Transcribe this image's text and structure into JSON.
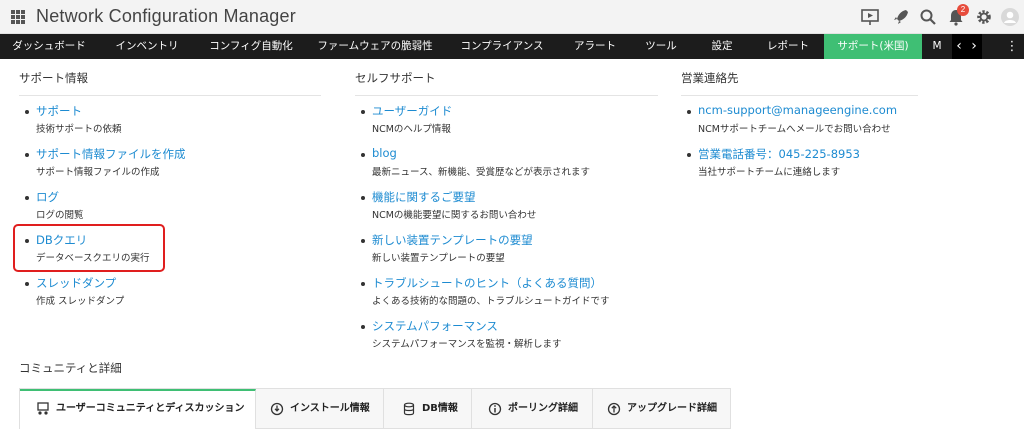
{
  "header": {
    "app_title": "Network Configuration Manager",
    "notification_count": "2",
    "icons": [
      "apps-grid-icon",
      "presentation-icon",
      "rocket-icon",
      "search-icon",
      "bell-icon",
      "gear-icon",
      "user-avatar-icon"
    ]
  },
  "nav": {
    "items": [
      "ダッシュボード",
      "インベントリ",
      "コンフィグ自動化",
      "ファームウェアの脆弱性",
      "コンプライアンス",
      "アラート",
      "ツール",
      "設定",
      "レポート",
      "サポート(米国)",
      "M"
    ],
    "active_color": "#3fbf74"
  },
  "support": {
    "title": "サポート情報",
    "items": [
      {
        "label": "サポート",
        "desc": "技術サポートの依頼"
      },
      {
        "label": "サポート情報ファイルを作成",
        "desc": "サポート情報ファイルの作成"
      },
      {
        "label": "ログ",
        "desc": "ログの閲覧"
      },
      {
        "label": "DBクエリ",
        "desc": "データベースクエリの実行"
      },
      {
        "label": "スレッドダンプ",
        "desc": "作成 スレッドダンプ"
      }
    ]
  },
  "selfsupport": {
    "title": "セルフサポート",
    "items": [
      {
        "label": "ユーザーガイド",
        "desc": "NCMのヘルプ情報"
      },
      {
        "label": "blog",
        "desc": "最新ニュース、新機能、受賞歴などが表示されます"
      },
      {
        "label": "機能に関するご要望",
        "desc": "NCMの機能要望に関するお問い合わせ"
      },
      {
        "label": "新しい装置テンプレートの要望",
        "desc": "新しい装置テンプレートの要望"
      },
      {
        "label": "トラブルシュートのヒント（よくある質問）",
        "desc": "よくある技術的な問題の、トラブルシュートガイドです"
      },
      {
        "label": "システムパフォーマンス",
        "desc": "システムパフォーマンスを監視・解析します"
      }
    ]
  },
  "sales": {
    "title": "営業連絡先",
    "items": [
      {
        "label": "ncm-support@manageengine.com",
        "desc": "NCMサポートチームへメールでお問い合わせ"
      },
      {
        "label": "営業電話番号：045-225-8953",
        "desc": "当社サポートチームに連絡します"
      }
    ]
  },
  "community": {
    "title": "コミュニティと詳細",
    "tabs": [
      "ユーザーコミュニティとディスカッション",
      "インストール情報",
      "DB情報",
      "ポーリング詳細",
      "アップグレード詳細"
    ]
  },
  "colors": {
    "link": "#1d8bd1",
    "highlight": "#e01e1e",
    "navbar": "#1c1c1c"
  }
}
